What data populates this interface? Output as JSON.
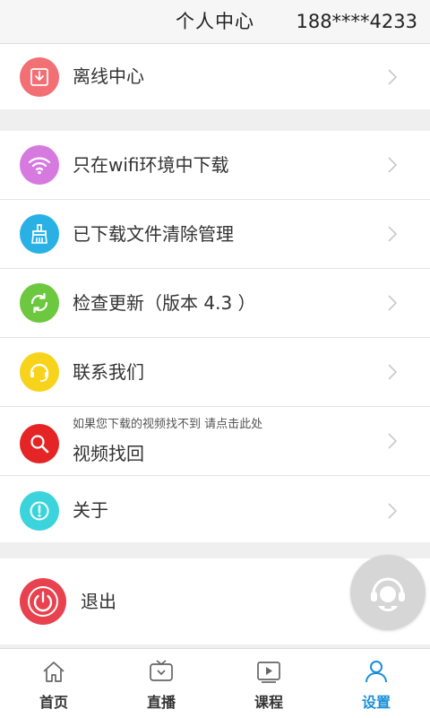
{
  "header": {
    "title": "个人中心",
    "phone": "188****4233"
  },
  "offline": {
    "label": "离线中心"
  },
  "settings": {
    "wifi_label": "只在wifi环境中下载",
    "clean_label": "已下载文件清除管理",
    "update_label": "检查更新（版本  4.3 ）",
    "contact_label": "联系我们",
    "recover_hint": "如果您下载的视频找不到 请点击此处",
    "recover_label": "视频找回",
    "about_label": "关于"
  },
  "logout": {
    "label": "退出"
  },
  "tabs": [
    {
      "label": "首页",
      "icon": "home-icon"
    },
    {
      "label": "直播",
      "icon": "tv-icon"
    },
    {
      "label": "课程",
      "icon": "play-icon"
    },
    {
      "label": "设置",
      "icon": "user-icon",
      "active": true
    }
  ],
  "colors": {
    "offline": "#f26f74",
    "wifi": "#d77ae0",
    "clean": "#29b1e6",
    "update": "#6cc83f",
    "contact": "#f7d31c",
    "recover": "#e52525",
    "about": "#3cd4dc",
    "logout": "#e8424e",
    "active_tab": "#1a8fd8"
  }
}
